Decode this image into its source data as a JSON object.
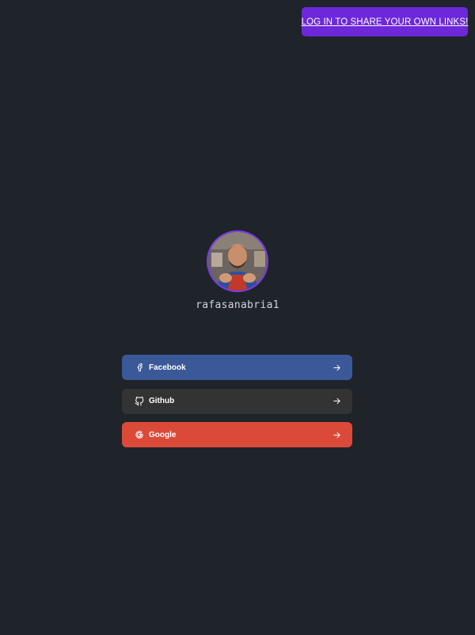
{
  "header": {
    "login_label": "LOG IN TO SHARE YOUR OWN LINKS!"
  },
  "profile": {
    "username": "rafasanabria1"
  },
  "links": [
    {
      "label": "Facebook",
      "icon": "facebook-icon",
      "color": "#3b5998"
    },
    {
      "label": "Github",
      "icon": "github-icon",
      "color": "#333333"
    },
    {
      "label": "Google",
      "icon": "google-icon",
      "color": "#db4a39"
    }
  ],
  "colors": {
    "background": "#1f232a",
    "accent": "#6d28d9",
    "avatar_border": "#7c3aed"
  }
}
